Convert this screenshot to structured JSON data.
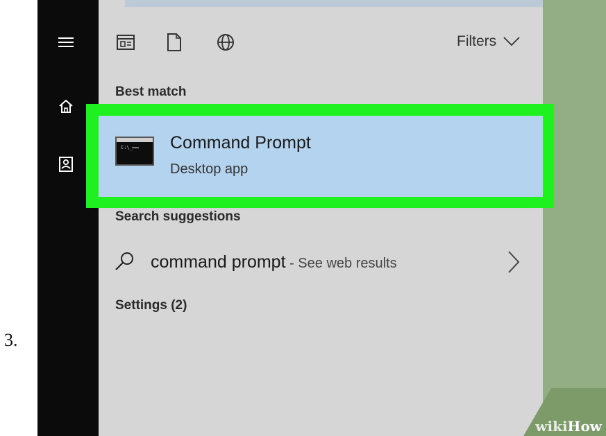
{
  "step": {
    "number": "3."
  },
  "sidebar": {
    "icons": [
      {
        "name": "hamburger-menu-icon"
      },
      {
        "name": "home-icon"
      },
      {
        "name": "user-account-icon"
      }
    ]
  },
  "toolbar": {
    "icons": [
      "apps-filter-icon",
      "documents-filter-icon",
      "web-filter-icon"
    ],
    "filters_label": "Filters"
  },
  "sections": {
    "best_match": "Best match",
    "search_suggestions": "Search suggestions",
    "settings": "Settings (2)"
  },
  "best_match_result": {
    "title": "Command Prompt",
    "subtitle": "Desktop app",
    "icon": "command-prompt-app-icon"
  },
  "suggestion": {
    "query": "command prompt",
    "hint": " - See web results"
  },
  "watermark": {
    "wiki": "wiki",
    "how": "How"
  },
  "colors": {
    "sidebar": "#0b0b0b",
    "panel": "#d6d6d6",
    "selected_result": "#b3d3ef",
    "highlight": "#1ff01f",
    "background_right": "#93ad84"
  }
}
